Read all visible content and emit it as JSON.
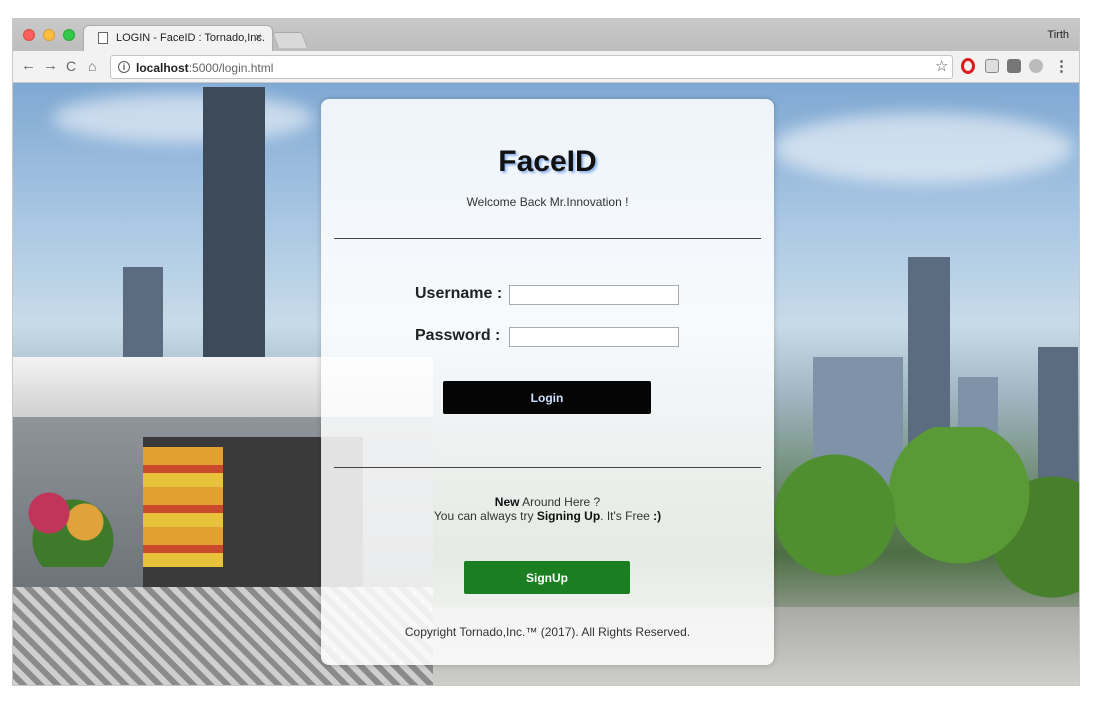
{
  "browser": {
    "tab_title": "LOGIN - FaceID : Tornado,Inc.",
    "tab_close": "×",
    "profile_name": "Tirth",
    "url_host": "localhost",
    "url_rest": ":5000/login.html",
    "nav_back": "←",
    "nav_forward": "→",
    "nav_reload": "C",
    "nav_home": "⌂",
    "star": "☆",
    "menu": "⋮",
    "info": "i"
  },
  "login": {
    "brand": "FaceID",
    "tagline": "Welcome Back Mr.Innovation !",
    "username_label": "Username :",
    "username_value": "",
    "password_label": "Password :",
    "password_value": "",
    "login_button": "Login",
    "new_prefix": "New",
    "new_suffix": " Around Here ?",
    "try_prefix": "You can always try ",
    "try_bold": "Signing Up",
    "try_mid": ". It's Free ",
    "try_smile": ":)",
    "signup_button": "SignUp",
    "copyright": "Copyright Tornado,Inc.™ (2017). All Rights Reserved."
  },
  "colors": {
    "login_button_bg": "#050505",
    "signup_button_bg": "#1b7f22",
    "accent_text": "#cfe0ff"
  }
}
